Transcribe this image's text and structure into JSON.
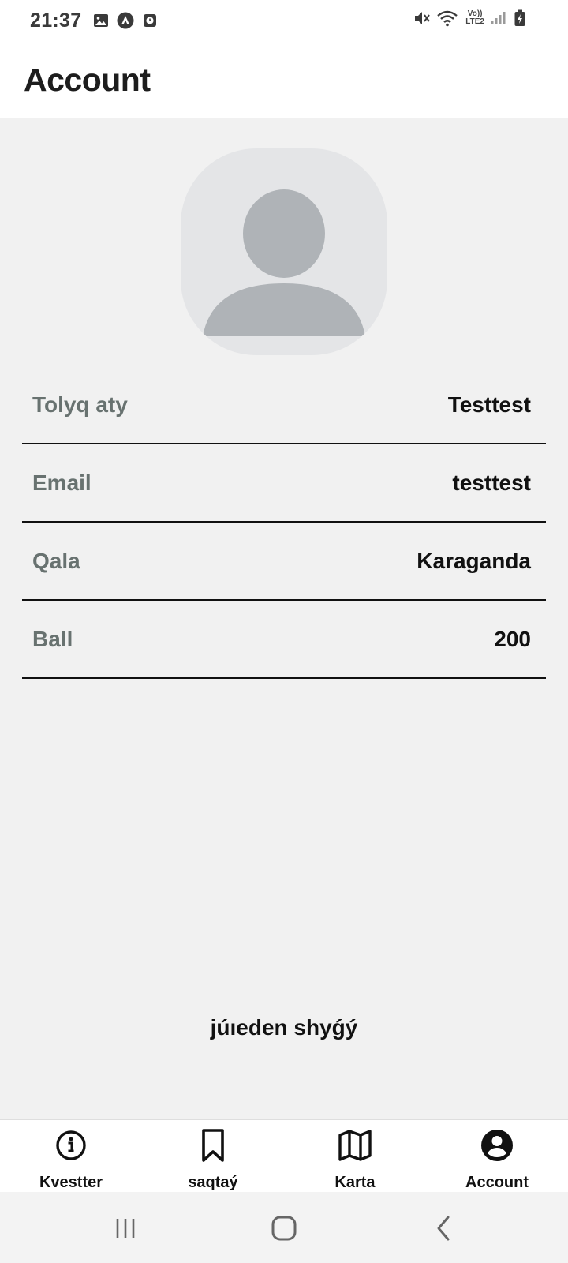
{
  "status_bar": {
    "time": "21:37",
    "network_volte": "Vo))",
    "network_lte": "LTE2"
  },
  "header": {
    "title": "Account"
  },
  "profile": {
    "avatar_icon": "user-avatar-icon",
    "rows": [
      {
        "label": "Tolyq aty",
        "value": "Testtest"
      },
      {
        "label": "Email",
        "value": "testtest"
      },
      {
        "label": "Qala",
        "value": "Karaganda"
      },
      {
        "label": "Ball",
        "value": "200"
      }
    ]
  },
  "logout_label": "júıeden shyǵý",
  "bottom_nav": {
    "items": [
      {
        "label": "Kvestter",
        "icon": "info-icon"
      },
      {
        "label": "saqtaý",
        "icon": "bookmark-icon"
      },
      {
        "label": "Karta",
        "icon": "map-icon"
      },
      {
        "label": "Account",
        "icon": "account-circle-icon"
      }
    ]
  },
  "system_nav": {
    "icons": [
      "recent-apps-icon",
      "home-icon",
      "back-icon"
    ]
  },
  "colors": {
    "background": "#f1f1f1",
    "surface": "#ffffff",
    "label": "#687270",
    "avatar_bg": "#e4e5e7",
    "avatar_fg": "#afb3b7"
  }
}
